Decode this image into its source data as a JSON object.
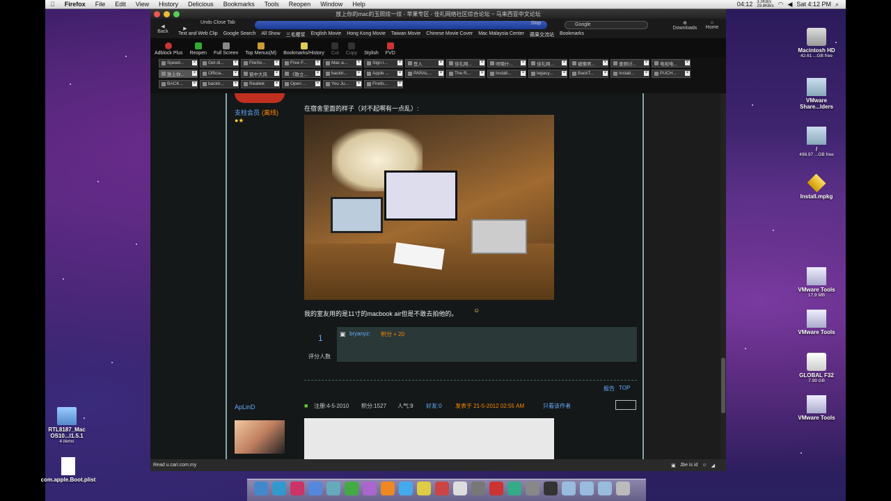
{
  "menubar": {
    "apple": "",
    "app": "Firefox",
    "items": [
      "File",
      "Edit",
      "View",
      "History",
      "Delicious",
      "Bookmarks",
      "Tools",
      "Reopen",
      "Window",
      "Help"
    ],
    "clock": "04:12",
    "rate1": "3.3KB/s",
    "rate2": "29.8KB/s",
    "datetime": "Sat 4:12 PM"
  },
  "window": {
    "title": "放上你的mac的玉照炫一炫 - 苹果专区 - 佳礼网络社区综合论坛 ~ 马来西亚中文论坛",
    "back": "Back",
    "undo": "Undo Close Tab",
    "textwebclip": "Text and Web Clip",
    "stop": "Stop",
    "search_engine": "Google",
    "downloads": "Downloads",
    "home": "Home",
    "bookmarks": [
      "Google Search",
      "All Show",
      "三毛樱浆",
      "English Movie",
      "Hong Kong Movie",
      "Taiwan Movie",
      "Chinese Movie Cover",
      "Mac Malaysia Center",
      "蘋果交流站",
      "Bookmarks"
    ],
    "toolbar": [
      "Adblock Plus",
      "Reopen",
      "Full Screen",
      "Top Menus(M)",
      "Bookmarks/History",
      "Cut",
      "Copy",
      "Stylish",
      "FVD"
    ],
    "tabs1": [
      "Speed...",
      "Get di...",
      "FileSo...",
      "Free F...",
      "Mac a...",
      "Sign i...",
      "登入",
      "佳礼网...",
      "呀喃什...",
      "佳礼网...",
      "被懒男...",
      "查厕讨...",
      "电视电..."
    ],
    "tabs2": [
      "放上你...",
      "Officia...",
      "窗中大风",
      "《散立...",
      "backtr...",
      "Apple ...",
      "PARAL...",
      "The R...",
      "Install...",
      "legacy...",
      "BackT...",
      "Install...",
      "PUCH..."
    ],
    "tabs3": [
      "BACK...",
      "backtr...",
      "Realtek",
      "Open ...",
      "You Ju...",
      "Firefo..."
    ],
    "status": "Read u.cari.com.my",
    "status_right": "Jbe is id"
  },
  "post": {
    "role": "支柱会员",
    "status": "(离线)",
    "caption1": "在宿舍里面的样子（对不起啊有一点乱）:",
    "caption2": "我的室友用的是11寸的macbook air但是不敢去拍他的。",
    "rating_count": "1",
    "rating_label": "评分人数",
    "rater": "bryanyz:",
    "score": "积分 + 20",
    "report": "报告",
    "top": "TOP"
  },
  "post2": {
    "user": "ApLinD",
    "reg": "注册:4-5-2010",
    "points": "积分:1527",
    "pop": "人气:9",
    "friends": "好友:0",
    "posted": "发表于 21-5-2012 02:55 AM",
    "only_author": "只看该作者"
  },
  "desktop": [
    {
      "name": "Macintosh HD",
      "sub": "42.61 ...GB free"
    },
    {
      "name": "VMware Share...lders",
      "sub": ""
    },
    {
      "name": "/",
      "sub": "498.97 ...GB free"
    },
    {
      "name": "Install.mpkg",
      "sub": ""
    },
    {
      "name": "VMware Tools",
      "sub": "17.9 MB"
    },
    {
      "name": "VMware Tools",
      "sub": ""
    },
    {
      "name": "GLOBAL F32",
      "sub": "7.99 GB"
    },
    {
      "name": "VMware Tools",
      "sub": ""
    },
    {
      "name": "RTL8187_Mac OS10...l1.5.1",
      "sub": "4 items"
    },
    {
      "name": "com.apple.Boot.plist",
      "sub": ""
    }
  ]
}
